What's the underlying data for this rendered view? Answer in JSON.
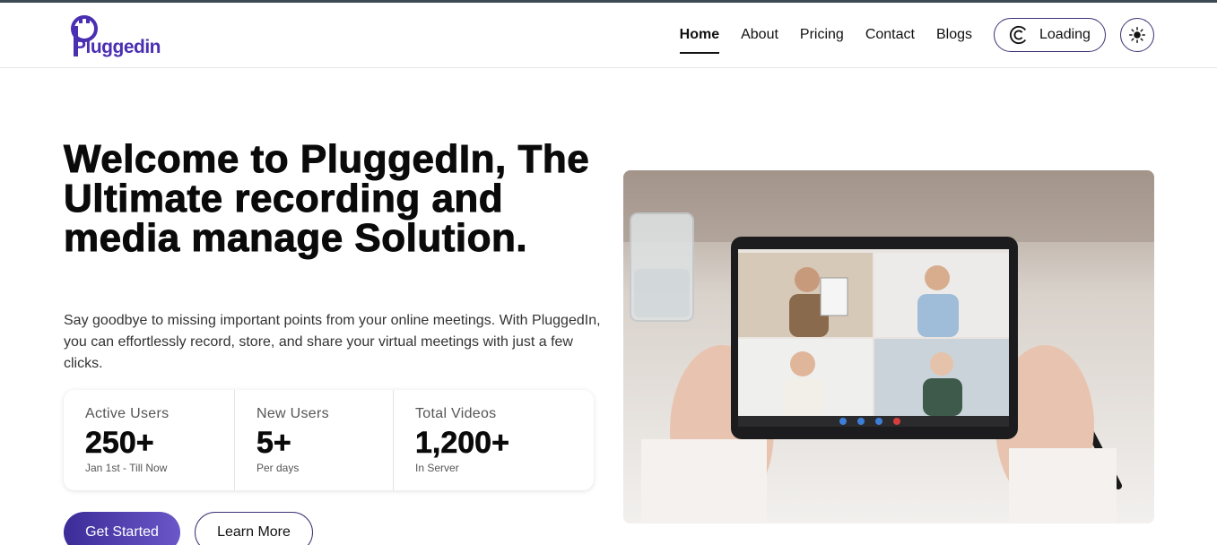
{
  "brand": {
    "logo_text": "Pluggedin",
    "color": "#4b2fb2"
  },
  "nav": {
    "items": [
      {
        "label": "Home",
        "active": true
      },
      {
        "label": "About",
        "active": false
      },
      {
        "label": "Pricing",
        "active": false
      },
      {
        "label": "Contact",
        "active": false
      },
      {
        "label": "Blogs",
        "active": false
      }
    ],
    "loading_label": "Loading",
    "theme_icon": "sun-icon"
  },
  "hero": {
    "title": "Welcome to PluggedIn, The Ultimate recording and media manage Solution.",
    "description": "Say goodbye to missing important points from your online meetings. With PluggedIn, you can effortlessly record, store, and share your virtual meetings with just a few clicks.",
    "stats": [
      {
        "label": "Active Users",
        "value": "250+",
        "sub": "Jan 1st - Till Now"
      },
      {
        "label": "New Users",
        "value": "5+",
        "sub": "Per days"
      },
      {
        "label": "Total Videos",
        "value": "1,200+",
        "sub": "In Server"
      }
    ],
    "primary_cta": "Get Started",
    "secondary_cta": "Learn More"
  },
  "colors": {
    "accent": "#3b2c98",
    "border": "#3b3275"
  }
}
